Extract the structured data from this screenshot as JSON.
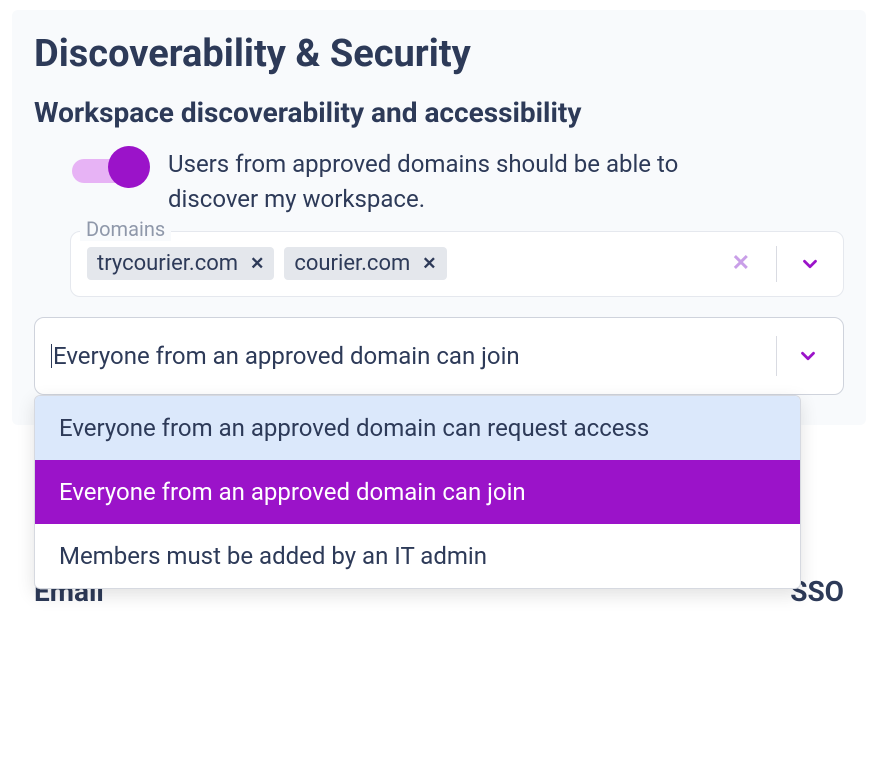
{
  "header": {
    "title": "Discoverability & Security"
  },
  "section": {
    "title": "Workspace discoverability and accessibility",
    "toggle": {
      "on": true,
      "label": "Users from approved domains should be able to discover my workspace."
    }
  },
  "domains": {
    "legend": "Domains",
    "chips": [
      "trycourier.com",
      "courier.com"
    ]
  },
  "accessSelect": {
    "value": "Everyone from an approved domain can join",
    "options": [
      {
        "label": "Everyone from an approved domain can request access",
        "state": "highlight"
      },
      {
        "label": "Everyone from an approved domain can join",
        "state": "selected"
      },
      {
        "label": "Members must be added by an IT admin",
        "state": ""
      }
    ]
  },
  "footer": {
    "left": "Email",
    "right": "SSO"
  },
  "colors": {
    "accent": "#9b13c9"
  }
}
